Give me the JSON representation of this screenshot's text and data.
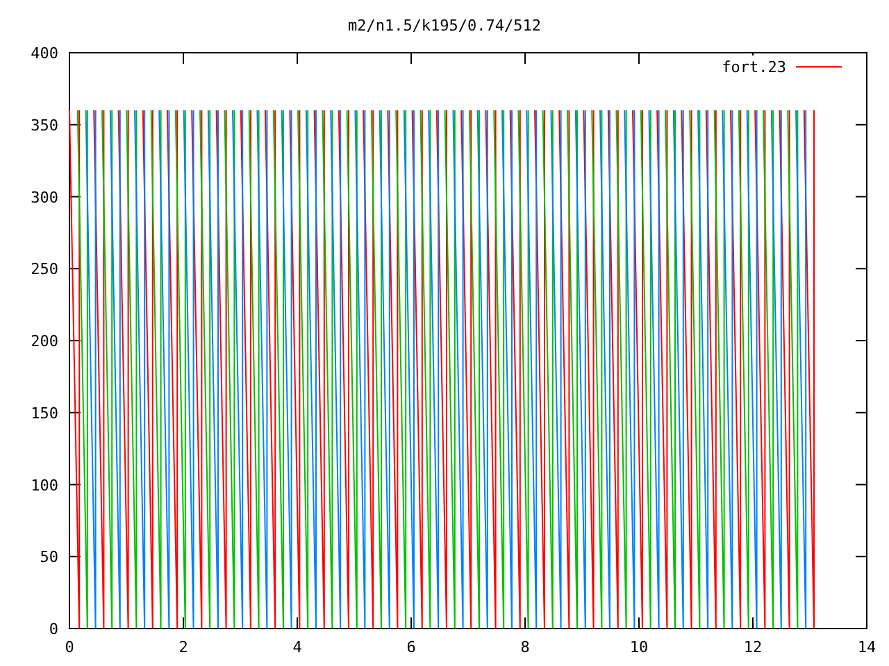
{
  "title": "m2/n1.5/k195/0.74/512",
  "y_ticks": [
    "400",
    "350",
    "300",
    "250",
    "200",
    "150",
    "100",
    "50",
    "0"
  ],
  "x_ticks": [
    "0",
    "2",
    "4",
    "6",
    "8",
    "10",
    "12",
    "14"
  ],
  "legend": {
    "label": "fort.23",
    "color": "#ff0000"
  },
  "traces": [
    {
      "color": "#ff0000"
    },
    {
      "color": "#00c000"
    },
    {
      "color": "#0080ff"
    }
  ]
}
